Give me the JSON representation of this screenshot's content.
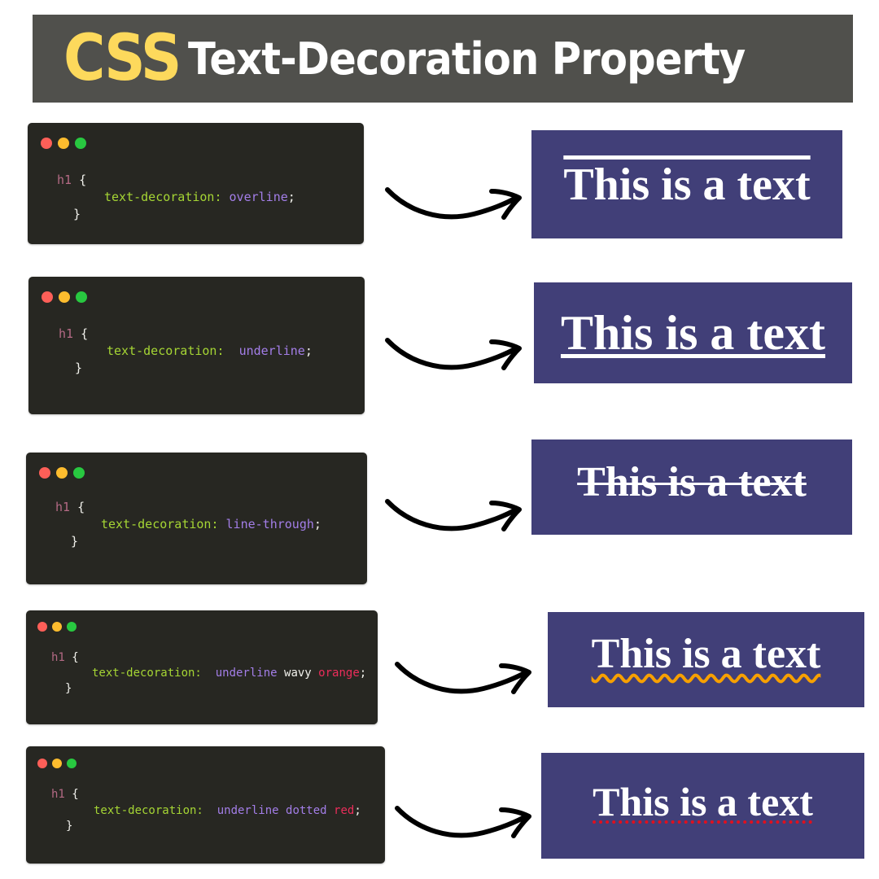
{
  "header": {
    "highlight": "CSS",
    "title": "Text-Decoration Property",
    "highlight_color": "#fdd95c"
  },
  "examples": [
    {
      "selector": "h1",
      "open_brace": "{",
      "property": "text-decoration:",
      "values": [
        {
          "text": "overline",
          "role": "keyword"
        }
      ],
      "semicolon": ";",
      "close_brace": "}",
      "preview_text": "This is a text",
      "decoration": "overline"
    },
    {
      "selector": "h1",
      "open_brace": "{",
      "property": "text-decoration:",
      "values": [
        {
          "text": "underline",
          "role": "keyword"
        }
      ],
      "semicolon": ";",
      "close_brace": "}",
      "preview_text": "This is a text",
      "decoration": "underline"
    },
    {
      "selector": "h1",
      "open_brace": "{",
      "property": "text-decoration:",
      "values": [
        {
          "text": "line-through",
          "role": "keyword"
        }
      ],
      "semicolon": ";",
      "close_brace": "}",
      "preview_text": "This is a text",
      "decoration": "line-through"
    },
    {
      "selector": "h1",
      "open_brace": "{",
      "property": "text-decoration:",
      "values": [
        {
          "text": "underline",
          "role": "keyword"
        },
        {
          "text": "wavy",
          "role": "style"
        },
        {
          "text": "orange",
          "role": "color"
        }
      ],
      "semicolon": ";",
      "close_brace": "}",
      "preview_text": "This is a text",
      "decoration": "underline wavy orange",
      "decoration_color": "#f7a000"
    },
    {
      "selector": "h1",
      "open_brace": "{",
      "property": "text-decoration:",
      "values": [
        {
          "text": "underline",
          "role": "keyword"
        },
        {
          "text": "dotted",
          "role": "keyword"
        },
        {
          "text": "red",
          "role": "color"
        }
      ],
      "semicolon": ";",
      "close_brace": "}",
      "preview_text": "This is a text",
      "decoration": "underline dotted red",
      "decoration_color": "#e0101e"
    }
  ],
  "colors": {
    "code_bg": "#272722",
    "preview_bg": "#413f78",
    "selector": "#b46a85",
    "property": "#a5d534",
    "value": "#a37ee8",
    "color_value": "#ea2d5a",
    "dot_red": "#fe5f58",
    "dot_yellow": "#fdbc2e",
    "dot_green": "#28c840"
  }
}
